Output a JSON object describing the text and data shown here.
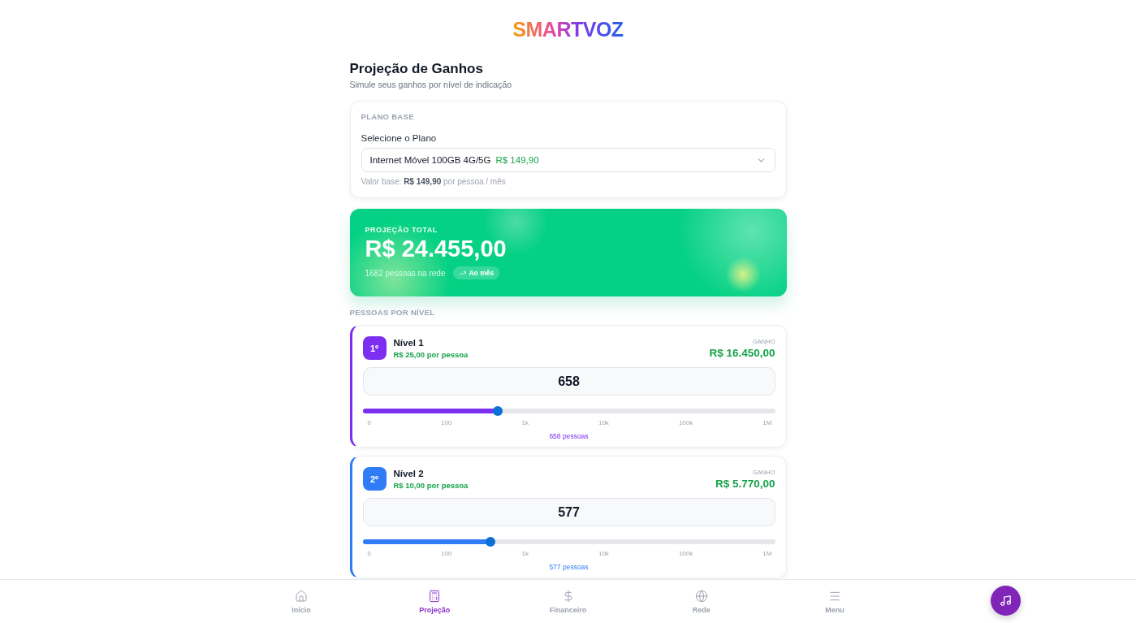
{
  "logo": "SMARTVOZ",
  "header": {
    "title": "Projeção de Ganhos",
    "subtitle": "Simule seus ganhos por nível de indicação"
  },
  "plan_card": {
    "heading": "PLANO BASE",
    "label": "Selecione o Plano",
    "select_value": "Internet Móvel 100GB 4G/5G",
    "select_price": "R$ 149,90",
    "note": "Valor base: **R$ 149,90** por pessoa / mês"
  },
  "total_card": {
    "label": "PROJEÇÃO TOTAL",
    "amount": "R$ 24.455,00",
    "people": "1682 pessoas na rede",
    "badge": "Ao mês"
  },
  "levels_heading": "PESSOAS POR NÍVEL",
  "levels": [
    {
      "badge": "1º",
      "name": "Nível 1",
      "rate": "R$ 25,00 por pessoa",
      "gain_label": "GANHO",
      "gain": "R$ 16.450,00",
      "value": "658",
      "level": 0.327,
      "ticks": [
        "0",
        "100",
        "1k",
        "10k",
        "100k",
        "1M"
      ],
      "caption": "658 pessoas",
      "color": "#7c2ff0"
    },
    {
      "badge": "2º",
      "name": "Nível 2",
      "rate": "R$ 10,00 por pessoa",
      "gain_label": "GANHO",
      "gain": "R$ 5.770,00",
      "value": "577",
      "level": 0.311,
      "ticks": [
        "0",
        "100",
        "1k",
        "10k",
        "100k",
        "1M"
      ],
      "caption": "577 pessoas",
      "color": "#2f7cf6"
    }
  ],
  "nav": [
    {
      "kind": "home",
      "label": "Início",
      "selected": false
    },
    {
      "kind": "calculator",
      "label": "Projeção",
      "selected": true
    },
    {
      "kind": "dollar",
      "label": "Financeiro",
      "selected": false
    },
    {
      "kind": "globe",
      "label": "Rede",
      "selected": false
    },
    {
      "kind": "menu",
      "label": "Menu",
      "selected": false
    }
  ]
}
